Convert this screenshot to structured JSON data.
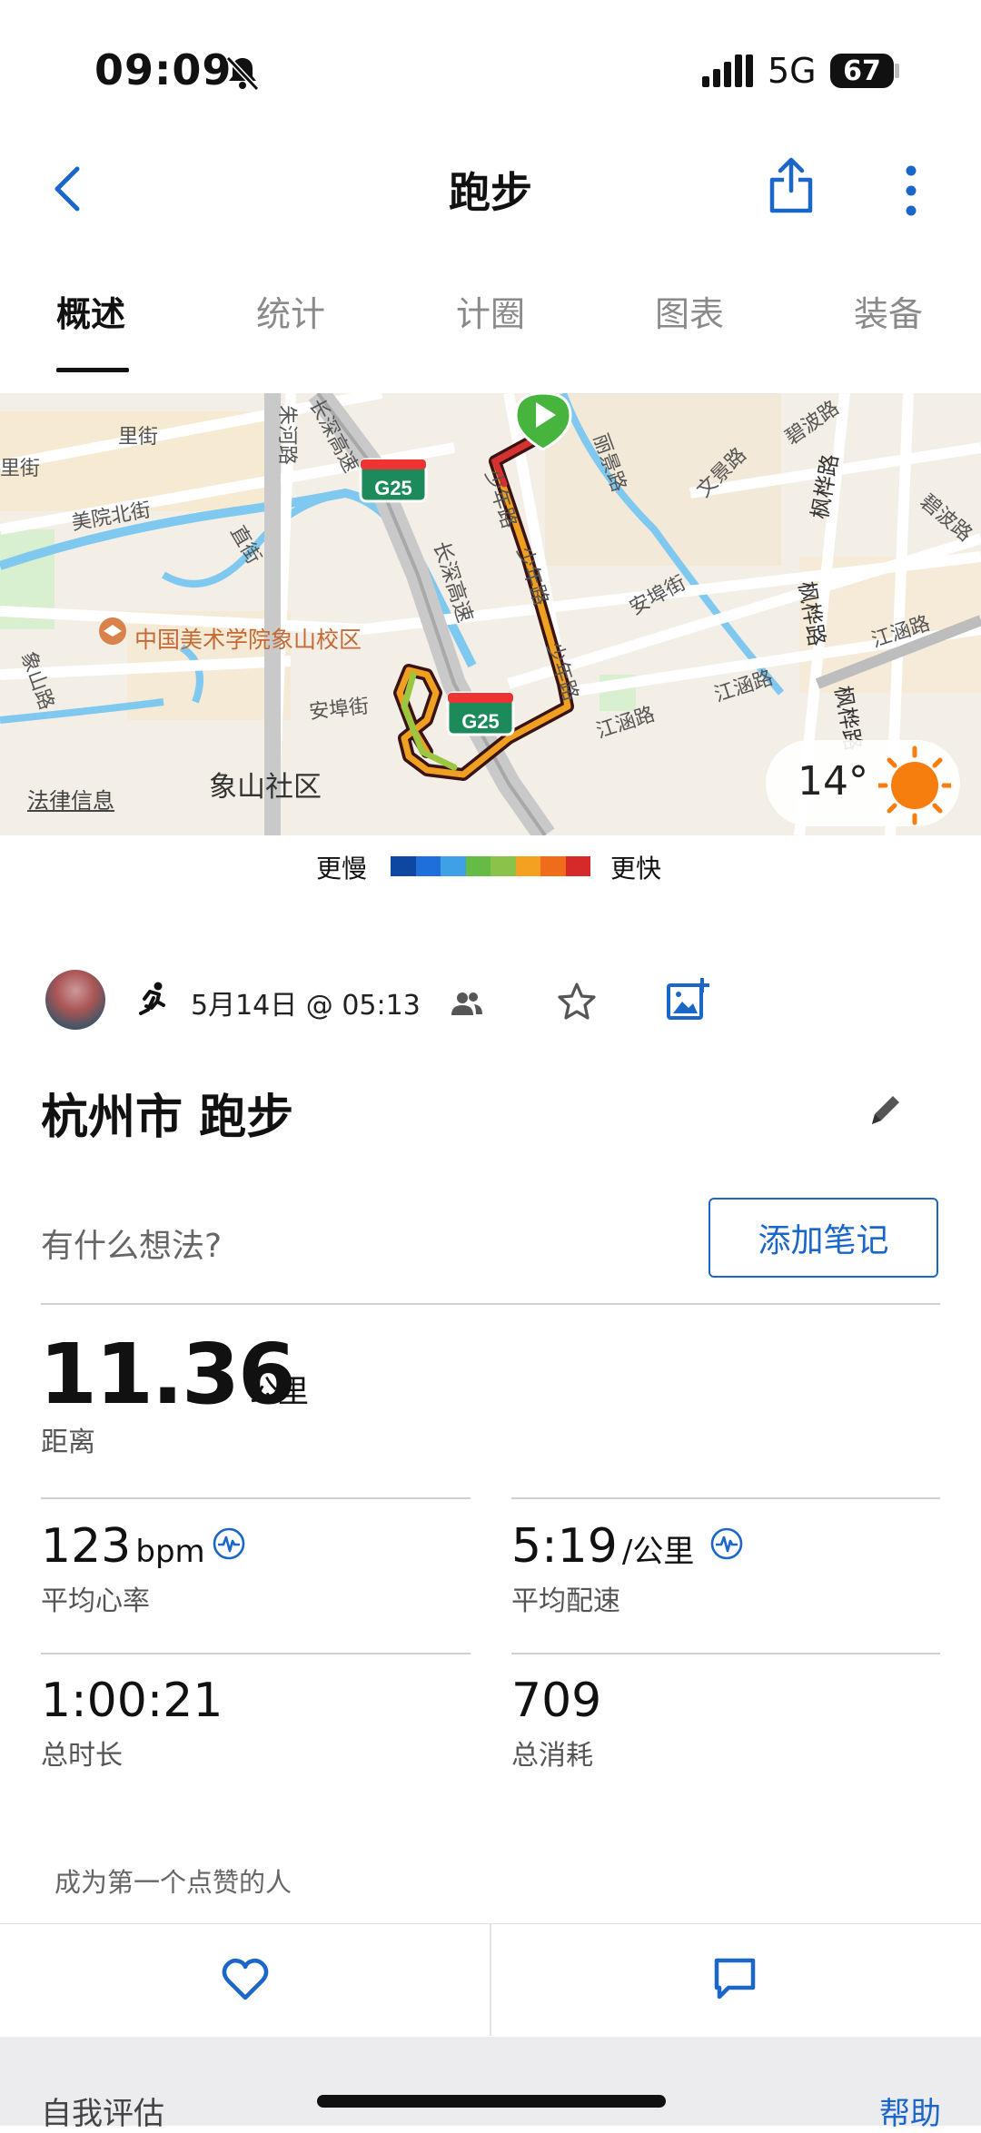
{
  "status_bar": {
    "time": "09:09",
    "network": "5G",
    "battery": "67"
  },
  "nav": {
    "title": "跑步"
  },
  "tabs": [
    {
      "label": "概述",
      "active": true
    },
    {
      "label": "统计",
      "active": false
    },
    {
      "label": "计圈",
      "active": false
    },
    {
      "label": "图表",
      "active": false
    },
    {
      "label": "装备",
      "active": false
    }
  ],
  "map": {
    "labels": {
      "l1": "里街",
      "l2": "里街",
      "l3": "美院北街",
      "l4": "直街",
      "l5": "朱河路",
      "l6": "长深高速",
      "l7": "中国美术学院象山校区",
      "l8": "象山路",
      "l9": "安埠街",
      "l10": "象山社区",
      "l11": "长深高速",
      "l12": "少年路",
      "l13": "少年路",
      "l14": "少年路",
      "l15": "丽景路",
      "l16": "文景路",
      "l17": "安埠街",
      "l18": "江涵路",
      "l19": "江涵路",
      "l20": "江涵路",
      "l21": "枫桦路",
      "l22": "枫桦路",
      "l23": "枫桦路",
      "l24": "碧波路",
      "l25": "碧波路"
    },
    "highway_shield": "G25",
    "weather_temp": "14°",
    "legal": "法律信息"
  },
  "legend": {
    "slow": "更慢",
    "fast": "更快",
    "colors": [
      "#0d47a1",
      "#1e6fd9",
      "#3fa0e8",
      "#66bb44",
      "#8bc34a",
      "#f4a020",
      "#ef6c1a",
      "#d62a2a"
    ]
  },
  "activity": {
    "date": "5月14日 @ 05:13",
    "title": "杭州市 跑步",
    "thought_placeholder": "有什么想法?",
    "add_note": "添加笔记",
    "distance": {
      "value": "11.36",
      "unit": "公里",
      "label": "距离"
    },
    "stats": {
      "heart_rate": {
        "value": "123",
        "unit": "bpm",
        "label": "平均心率"
      },
      "pace": {
        "value": "5:19",
        "unit": "/公里",
        "label": "平均配速"
      },
      "duration": {
        "value": "1:00:21",
        "label": "总时长"
      },
      "calories": {
        "value": "709",
        "label": "总消耗"
      }
    },
    "like_text": "成为第一个点赞的人"
  },
  "bottom": {
    "self_eval": "自我评估",
    "help": "帮助"
  }
}
